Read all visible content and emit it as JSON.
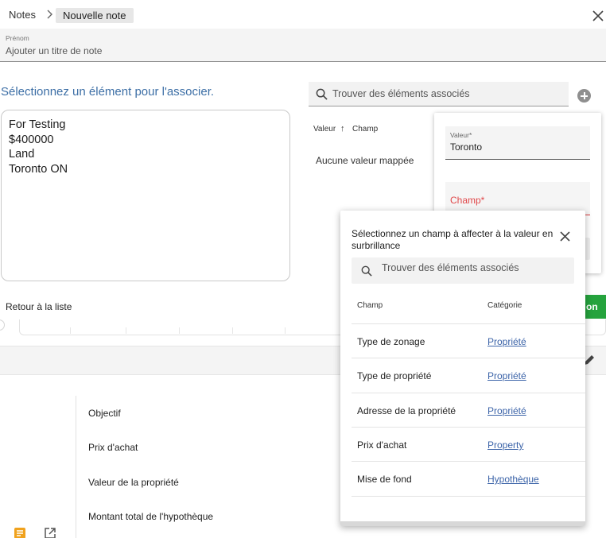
{
  "breadcrumb": {
    "root": "Notes",
    "current": "Nouvelle note"
  },
  "title_field": {
    "label": "Prénom",
    "placeholder": "Ajouter un titre de note"
  },
  "instruction": "Sélectionnez un élément pour l'associer.",
  "source_text": [
    "For Testing",
    "$400000",
    "Land",
    "Toronto ON"
  ],
  "search": {
    "placeholder": "Trouver des éléments associés"
  },
  "mapping_table": {
    "col_value": "Valeur",
    "sort_arrow": "↑",
    "col_field": "Champ",
    "empty": "Aucune valeur mappée"
  },
  "back_link": "Retour à la liste",
  "green_button": "on",
  "detail_fields": [
    "Objectif",
    "Prix d'achat",
    "Valeur de la propriété",
    "Montant total de l'hypothèque"
  ],
  "side_panel": {
    "value_label": "Valeur*",
    "value": "Toronto",
    "field_label": "Champ*"
  },
  "modal": {
    "title": "Sélectionnez un champ à affecter à la valeur en surbrillance",
    "search_placeholder": "Trouver des éléments associés",
    "col_field": "Champ",
    "col_category": "Catégorie",
    "rows": [
      {
        "field": "Type de zonage",
        "category": "Propriété"
      },
      {
        "field": "Type de propriété",
        "category": "Propriété"
      },
      {
        "field": "Adresse de la propriété",
        "category": "Propriété"
      },
      {
        "field": "Prix d'achat",
        "category": "Property"
      },
      {
        "field": "Mise de fond",
        "category": "Hypothèque"
      }
    ]
  },
  "colors": {
    "accent_blue": "#3d6fa6",
    "link_blue": "#3b63a8",
    "error_red": "#e0484a",
    "success_green": "#25a33d",
    "note_icon_orange": "#f0a21d"
  },
  "icons": [
    "chevron-right-icon",
    "close-icon",
    "search-icon",
    "add-circle-icon",
    "sort-up-arrow-icon",
    "pencil-icon",
    "note-icon",
    "external-link-icon"
  ]
}
